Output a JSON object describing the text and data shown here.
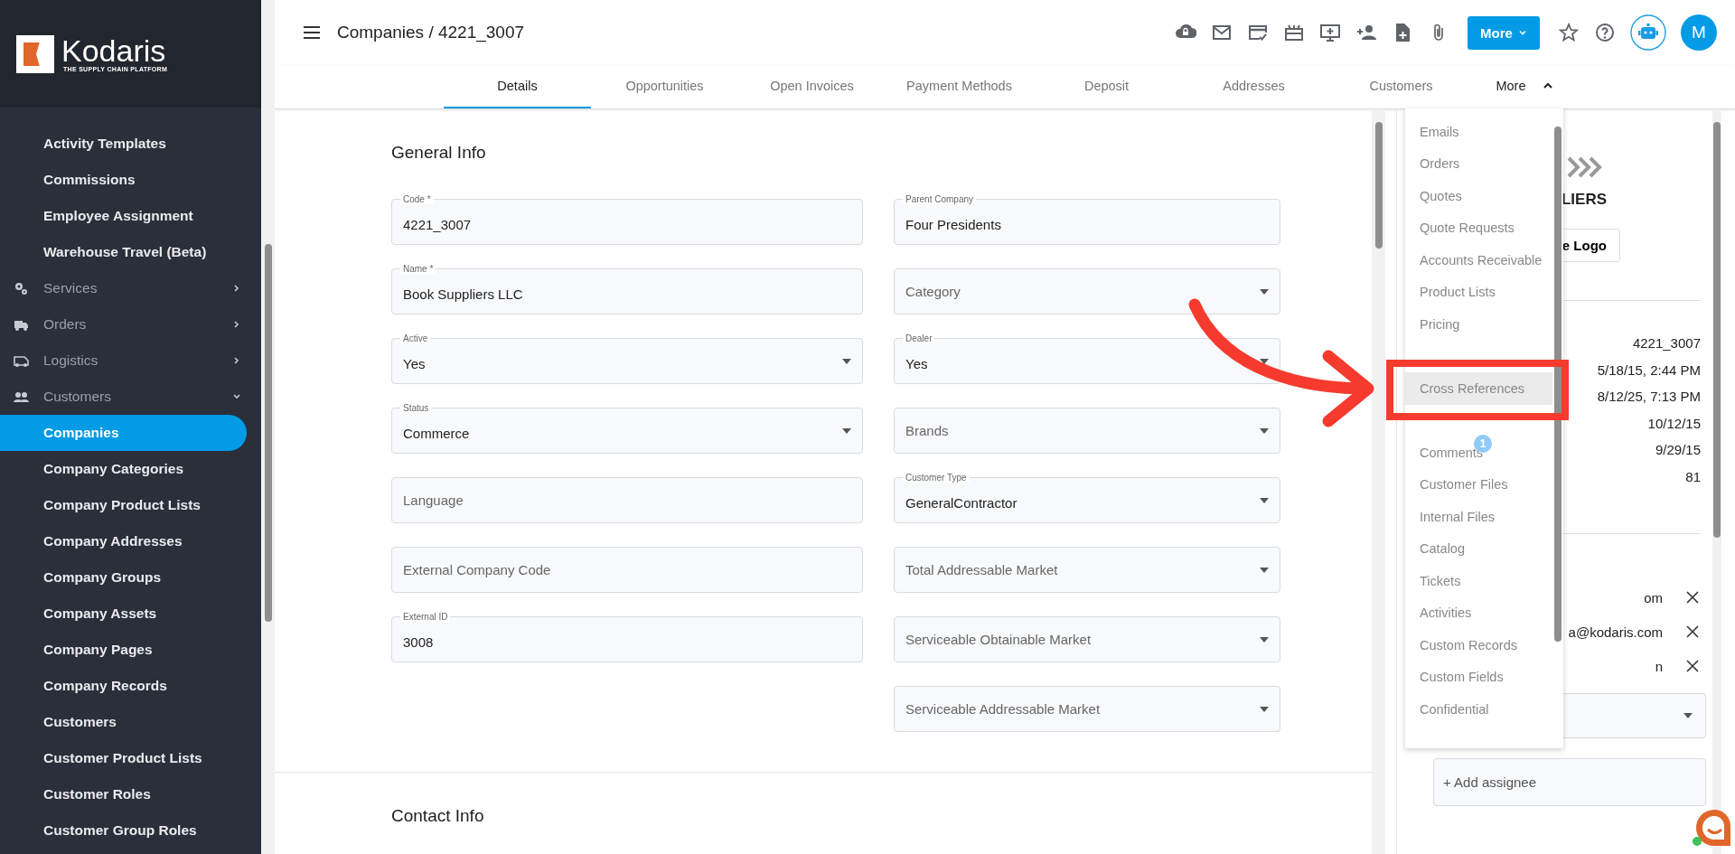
{
  "sidebar": {
    "logo": {
      "name": "Kodaris",
      "tagline": "THE SUPPLY CHAIN PLATFORM"
    },
    "items": [
      {
        "label": "Activity Templates",
        "kind": "link",
        "selected": false
      },
      {
        "label": "Commissions",
        "kind": "link",
        "selected": false
      },
      {
        "label": "Employee Assignment",
        "kind": "link",
        "selected": false
      },
      {
        "label": "Warehouse Travel (Beta)",
        "kind": "link",
        "selected": false
      },
      {
        "label": "Services",
        "kind": "group",
        "expanded": false
      },
      {
        "label": "Orders",
        "kind": "group",
        "expanded": false
      },
      {
        "label": "Logistics",
        "kind": "group",
        "expanded": false
      },
      {
        "label": "Customers",
        "kind": "group",
        "expanded": true
      },
      {
        "label": "Companies",
        "kind": "link",
        "selected": true
      },
      {
        "label": "Company Categories",
        "kind": "link",
        "selected": false
      },
      {
        "label": "Company Product Lists",
        "kind": "link",
        "selected": false
      },
      {
        "label": "Company Addresses",
        "kind": "link",
        "selected": false
      },
      {
        "label": "Company Groups",
        "kind": "link",
        "selected": false
      },
      {
        "label": "Company Assets",
        "kind": "link",
        "selected": false
      },
      {
        "label": "Company Pages",
        "kind": "link",
        "selected": false
      },
      {
        "label": "Company Records",
        "kind": "link",
        "selected": false
      },
      {
        "label": "Customers",
        "kind": "link",
        "selected": false
      },
      {
        "label": "Customer Product Lists",
        "kind": "link",
        "selected": false
      },
      {
        "label": "Customer Roles",
        "kind": "link",
        "selected": false
      },
      {
        "label": "Customer Group Roles",
        "kind": "link",
        "selected": false
      }
    ]
  },
  "header": {
    "breadcrumb": "Companies / 4221_3007",
    "more_button": "More",
    "avatar": "M"
  },
  "tabs": [
    {
      "label": "Details",
      "selected": true
    },
    {
      "label": "Opportunities",
      "selected": false
    },
    {
      "label": "Open Invoices",
      "selected": false
    },
    {
      "label": "Payment Methods",
      "selected": false
    },
    {
      "label": "Deposit",
      "selected": false
    },
    {
      "label": "Addresses",
      "selected": false
    },
    {
      "label": "Customers",
      "selected": false
    }
  ],
  "more_tab": {
    "label": "More",
    "expanded": true
  },
  "more_menu": {
    "items": [
      {
        "label": "Emails",
        "highlighted": false
      },
      {
        "label": "Orders",
        "highlighted": false
      },
      {
        "label": "Quotes",
        "highlighted": false
      },
      {
        "label": "Quote Requests",
        "highlighted": false
      },
      {
        "label": "Accounts Receivable",
        "highlighted": false
      },
      {
        "label": "Product Lists",
        "highlighted": false
      },
      {
        "label": "Pricing",
        "highlighted": false
      },
      {
        "kind": "covered"
      },
      {
        "label": "Cross References",
        "highlighted": true
      },
      {
        "kind": "covered"
      },
      {
        "label": "Comments",
        "highlighted": false,
        "badge": "1"
      },
      {
        "label": "Customer Files",
        "highlighted": false
      },
      {
        "label": "Internal Files",
        "highlighted": false
      },
      {
        "label": "Catalog",
        "highlighted": false
      },
      {
        "label": "Tickets",
        "highlighted": false
      },
      {
        "label": "Activities",
        "highlighted": false
      },
      {
        "label": "Custom Records",
        "highlighted": false
      },
      {
        "label": "Custom Fields",
        "highlighted": false
      },
      {
        "label": "Confidential",
        "highlighted": false
      }
    ]
  },
  "form": {
    "title": "General Info",
    "left_fields": [
      {
        "label": "Code *",
        "value": "4221_3007",
        "kind": "text"
      },
      {
        "label": "Name *",
        "value": "Book Suppliers LLC",
        "kind": "text"
      },
      {
        "label": "Active",
        "value": "Yes",
        "kind": "select"
      },
      {
        "label": "Status",
        "value": "Commerce",
        "kind": "select"
      },
      {
        "placeholder": "Language",
        "kind": "text"
      },
      {
        "placeholder": "External Company Code",
        "kind": "text"
      },
      {
        "label": "External ID",
        "value": "3008",
        "kind": "text"
      }
    ],
    "right_fields": [
      {
        "label": "Parent Company",
        "value": "Four Presidents",
        "kind": "text"
      },
      {
        "placeholder": "Category",
        "kind": "select"
      },
      {
        "label": "Dealer",
        "value": "Yes",
        "kind": "select"
      },
      {
        "placeholder": "Brands",
        "kind": "select"
      },
      {
        "label": "Customer Type",
        "value": "GeneralContractor",
        "kind": "select"
      },
      {
        "placeholder": "Total Addressable Market",
        "kind": "select"
      },
      {
        "placeholder": "Serviceable Obtainable Market",
        "kind": "select"
      },
      {
        "placeholder": "Serviceable Addressable Market",
        "kind": "select"
      }
    ]
  },
  "contact_section": {
    "title": "Contact Info"
  },
  "details_panel": {
    "logo_text": "LIERS",
    "logo_button": "e Logo",
    "values": [
      "4221_3007",
      "5/18/15, 2:44 PM",
      "8/12/25, 7:13 PM",
      "10/12/15",
      "9/29/15",
      "81"
    ],
    "assignees": [
      "om",
      "a@kodaris.com",
      "n"
    ],
    "add_assignee": "+ Add assignee"
  }
}
